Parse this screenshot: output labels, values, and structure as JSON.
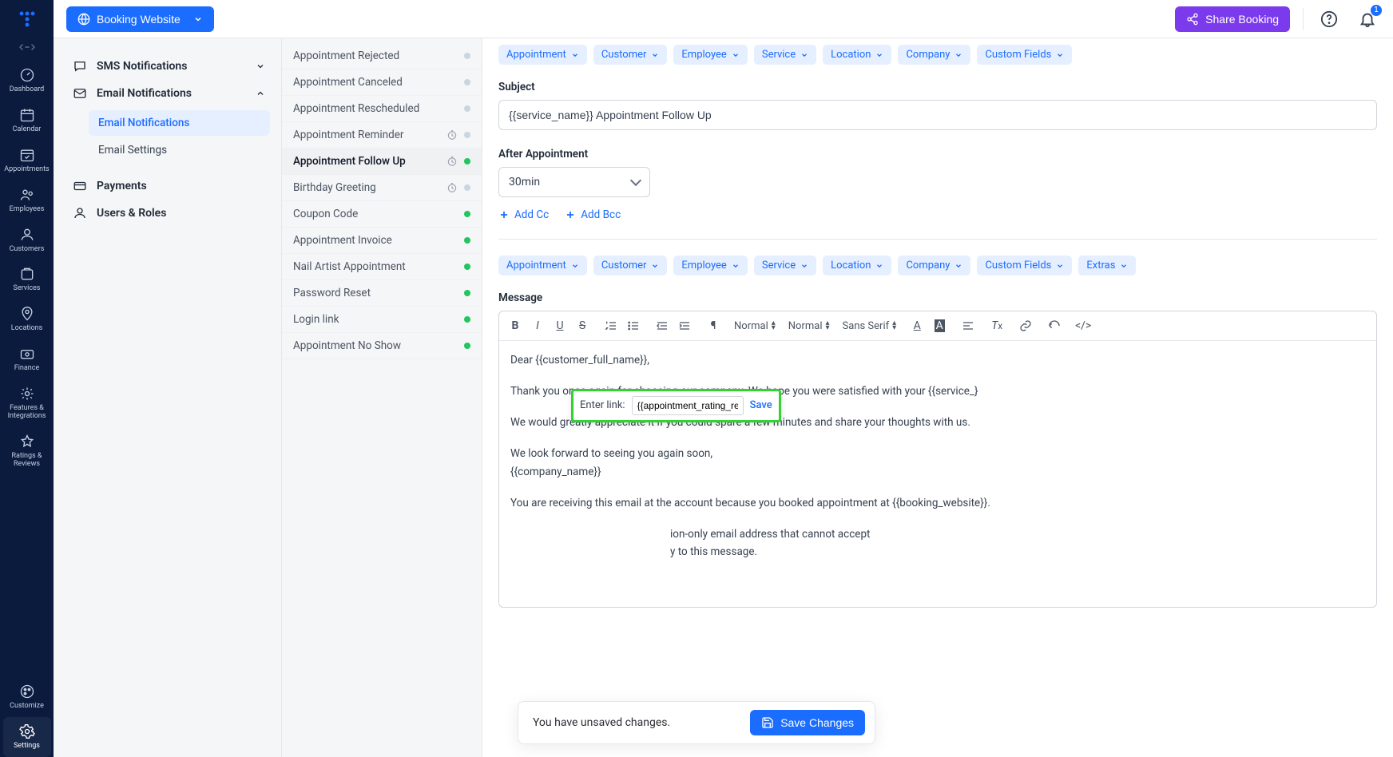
{
  "header": {
    "booking_label": "Booking Website",
    "share_label": "Share Booking",
    "notification_count": "1"
  },
  "sidenav": {
    "items": [
      {
        "id": "dashboard",
        "label": "Dashboard"
      },
      {
        "id": "calendar",
        "label": "Calendar"
      },
      {
        "id": "appointments",
        "label": "Appointments"
      },
      {
        "id": "employees",
        "label": "Employees"
      },
      {
        "id": "customers",
        "label": "Customers"
      },
      {
        "id": "services",
        "label": "Services"
      },
      {
        "id": "locations",
        "label": "Locations"
      },
      {
        "id": "finance",
        "label": "Finance"
      },
      {
        "id": "features",
        "label": "Features & Integrations"
      },
      {
        "id": "ratings",
        "label": "Ratings & Reviews"
      }
    ],
    "bottom_items": [
      {
        "id": "customize",
        "label": "Customize"
      },
      {
        "id": "settings",
        "label": "Settings"
      }
    ]
  },
  "settings_panel": {
    "sections": [
      {
        "id": "sms",
        "label": "SMS Notifications",
        "expanded": false
      },
      {
        "id": "email",
        "label": "Email Notifications",
        "expanded": true,
        "children": [
          {
            "id": "email-notif",
            "label": "Email Notifications",
            "active": true
          },
          {
            "id": "email-settings",
            "label": "Email Settings",
            "active": false
          }
        ]
      },
      {
        "id": "payments",
        "label": "Payments",
        "expanded": false
      },
      {
        "id": "users",
        "label": "Users & Roles",
        "expanded": false
      }
    ]
  },
  "notif_list": {
    "items": [
      {
        "label": "Appointment Rejected",
        "clock": false,
        "status": "gray"
      },
      {
        "label": "Appointment Canceled",
        "clock": false,
        "status": "gray"
      },
      {
        "label": "Appointment Rescheduled",
        "clock": false,
        "status": "gray"
      },
      {
        "label": "Appointment Reminder",
        "clock": true,
        "status": "gray"
      },
      {
        "label": "Appointment Follow Up",
        "clock": true,
        "status": "green",
        "selected": true
      },
      {
        "label": "Birthday Greeting",
        "clock": true,
        "status": "gray"
      },
      {
        "label": "Coupon Code",
        "clock": false,
        "status": "green"
      },
      {
        "label": "Appointment Invoice",
        "clock": false,
        "status": "green"
      },
      {
        "label": "Nail Artist Appointment",
        "clock": false,
        "status": "green"
      },
      {
        "label": "Password Reset",
        "clock": false,
        "status": "green"
      },
      {
        "label": "Login link",
        "clock": false,
        "status": "green"
      },
      {
        "label": "Appointment No Show",
        "clock": false,
        "status": "green"
      }
    ]
  },
  "chips1": [
    "Appointment",
    "Customer",
    "Employee",
    "Service",
    "Location",
    "Company",
    "Custom Fields"
  ],
  "chips2": [
    "Appointment",
    "Customer",
    "Employee",
    "Service",
    "Location",
    "Company",
    "Custom Fields",
    "Extras"
  ],
  "form": {
    "subject_label": "Subject",
    "subject_value": "{{service_name}} Appointment Follow Up",
    "after_label": "After Appointment",
    "after_value": "30min",
    "add_cc": "Add Cc",
    "add_bcc": "Add Bcc",
    "message_label": "Message"
  },
  "toolbar": {
    "size_label": "Normal",
    "header_label": "Normal",
    "font_label": "Sans Serif"
  },
  "message": {
    "p1": "Dear {{customer_full_name}},",
    "p2": "Thank you once again for choosing our company. We hope you were satisfied with your {{service_}",
    "p3": "We would greatly appreciate it if you could spare a few minutes and share your thoughts with us.",
    "p4": "We look forward to seeing you again soon,",
    "p5": "{{company_name}}",
    "p6": "You are receiving this email at the account because you booked appointment at {{booking_website}}.",
    "p7_tail": "ion-only email address that cannot accept",
    "p8_tail": "y to this message."
  },
  "link_popover": {
    "label": "Enter link:",
    "value": "{{appointment_rating_revi",
    "save": "Save"
  },
  "unsaved": {
    "text": "You have unsaved changes.",
    "button": "Save Changes"
  }
}
